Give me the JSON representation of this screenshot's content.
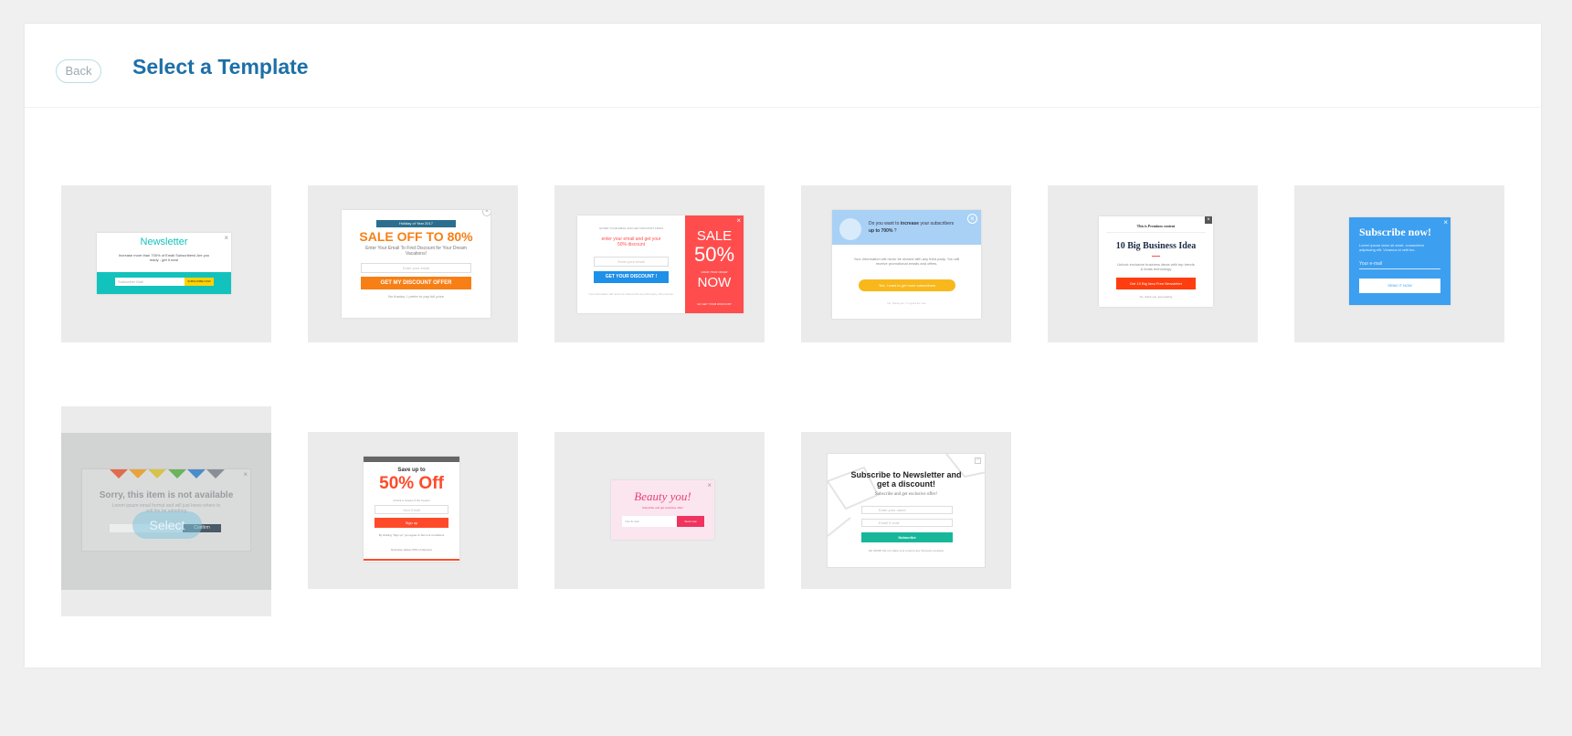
{
  "header": {
    "back_label": "Back",
    "title": "Select a Template"
  },
  "colors": {
    "title": "#1d6fa8",
    "card_bg": "#ebebeb",
    "teal": "#12c2bd",
    "orange": "#f77f16",
    "red": "#ff4d4d",
    "blue": "#3d9ff0"
  },
  "templates": [
    {
      "title": "Newsletter",
      "text": "Increase more than 700% of Email Subscribers! Are you ready - get it now!",
      "input_placeholder": "Subscriber Mail",
      "button": "SUBSCRIBE NOW"
    },
    {
      "badge": "Holiday of Year 2017",
      "title": "SALE OFF TO 80%",
      "subtitle": "Enter Your Email To Find Discount for Your Dream Vacations!",
      "input_placeholder": "Enter your email",
      "button": "GET MY DISCOUNT OFFER",
      "footer": "No thanks, I prefer to pay full price"
    },
    {
      "top_text": "ENTER YOUR EMAIL AND GET DISCOUNT FROM",
      "headline": "enter your email and get your 50% discount",
      "input_placeholder": "Enter your email",
      "button": "GET YOUR DISCOUNT !",
      "fine_print": "Your information will never be shared with any third party. We promise.",
      "sale_word": "SALE",
      "sale_pct": "50%",
      "sale_small": "GRAB YOUR OFFER",
      "sale_now": "NOW",
      "sale_footer": "GO GET YOUR DISCOUNT"
    },
    {
      "question_prefix": "Do you want to",
      "question_bold": "increase",
      "question_mid": "your subscribers",
      "question_bold2": "up to 700%",
      "question_end": "?",
      "body": "Your information will never be shared with any third party. You will receive promotional emails and offers.",
      "button": "Yes, I want to get more subscribers",
      "footer": "No, thank you, I'm good for now"
    },
    {
      "top": "This is Premium content",
      "title": "10 Big Business Idea",
      "body": "Unlock exclusive business ideas with top trends & leads technology",
      "button": "Get 10 Big Idea Free Newsletter",
      "footer": "No, thank you, just reading"
    },
    {
      "title": "Subscribe now!",
      "body": "Lorem ipsum dolor sit amet, consectetur adipiscing elit. Vivamus id velit leo.",
      "input_placeholder": "Your e-mail",
      "button": "SEND IT NOW"
    },
    {
      "title": "Sorry, this item is not available",
      "body": "Lorem ipsum email format and will just know where to sell the be adnetting",
      "button": "Confirm",
      "overlay_label": "Select"
    },
    {
      "title": "Save up to",
      "big": "50% Off",
      "sub": "Unlock a receipt of the coupon",
      "input_placeholder": "Your Email",
      "button": "Sign up",
      "fine": "By clicking \"Sign up\" you agree to Terms & Conditions",
      "footer": "Exclusive deliver 50% of discount"
    },
    {
      "title": "Beauty you!",
      "sub": "Subscribe and get exclusive offer!",
      "input_placeholder": "Your E-mail",
      "button": "Send now"
    },
    {
      "title": "Subscribe to Newsletter and get a discount!",
      "sub": "Subscribe and get exclusive offer!",
      "input1_placeholder": "Enter your name",
      "input2_placeholder": "Email E-mail",
      "button": "Subscribe",
      "footer": "We SPAM! We not share your email to any 3rd party company"
    }
  ]
}
